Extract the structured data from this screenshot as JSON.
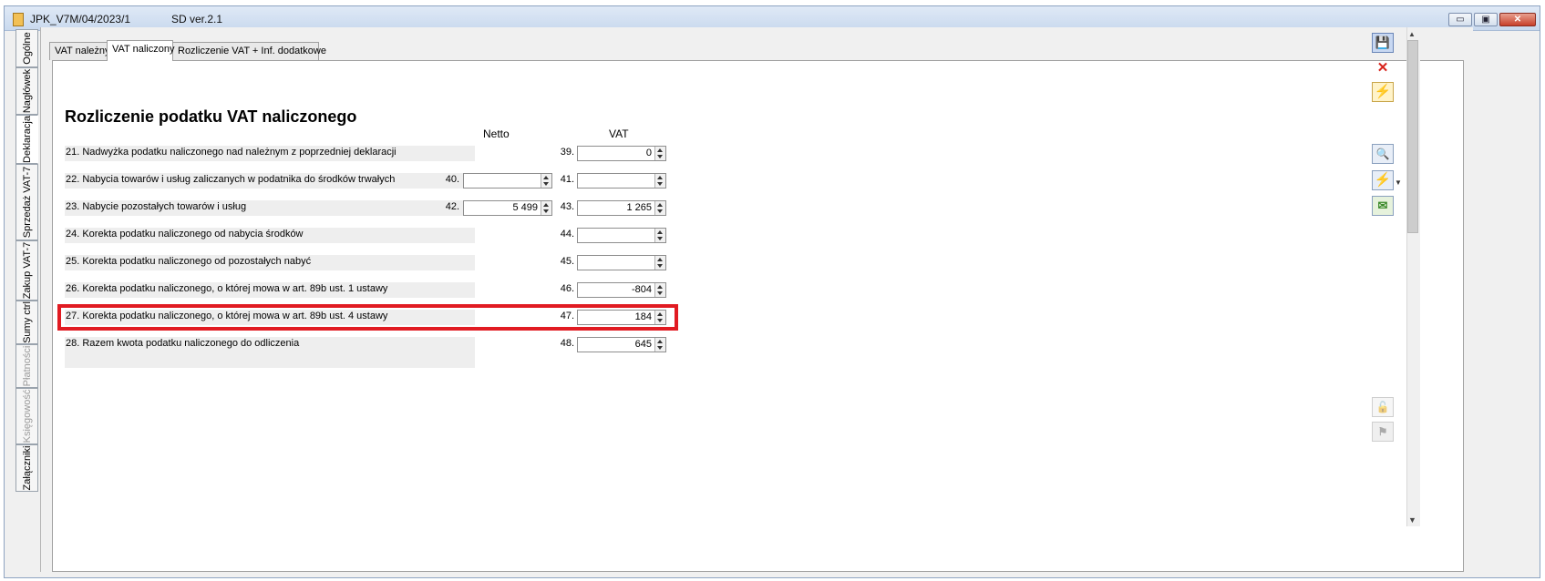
{
  "window": {
    "title": "JPK_V7M/04/2023/1",
    "version": "SD ver.2.1",
    "buttons": {
      "minimize": "▭",
      "maximize": "▣",
      "close": "✕"
    }
  },
  "side_tabs": [
    {
      "label": "Ogólne",
      "state": "normal"
    },
    {
      "label": "Nagłówek",
      "state": "normal"
    },
    {
      "label": "Deklaracja",
      "state": "active"
    },
    {
      "label": "Sprzedaż VAT-7",
      "state": "normal"
    },
    {
      "label": "Zakup VAT-7",
      "state": "normal"
    },
    {
      "label": "Sumy ctrl",
      "state": "normal"
    },
    {
      "label": "Płatności",
      "state": "disabled"
    },
    {
      "label": "Księgowość",
      "state": "disabled"
    },
    {
      "label": "Załączniki",
      "state": "normal"
    }
  ],
  "top_tabs": [
    {
      "label": "VAT należny",
      "active": false
    },
    {
      "label": "VAT naliczony",
      "active": true
    },
    {
      "label": "Rozliczenie VAT + Inf. dodatkowe",
      "active": false
    }
  ],
  "form": {
    "title": "Rozliczenie podatku VAT naliczonego",
    "col_netto": "Netto",
    "col_vat": "VAT",
    "rows": [
      {
        "label": "21. Nadwyżka podatku naliczonego nad należnym z poprzedniej deklaracji",
        "netto_num": "",
        "netto_value": null,
        "vat_num": "39.",
        "vat_value": "0"
      },
      {
        "label": "22. Nabycia towarów i usług zaliczanych w podatnika do środków trwałych",
        "netto_num": "40.",
        "netto_value": "",
        "vat_num": "41.",
        "vat_value": ""
      },
      {
        "label": "23. Nabycie pozostałych towarów i usług",
        "netto_num": "42.",
        "netto_value": "5 499",
        "vat_num": "43.",
        "vat_value": "1 265"
      },
      {
        "label": "24.  Korekta podatku naliczonego od nabycia środków",
        "netto_num": "",
        "netto_value": null,
        "vat_num": "44.",
        "vat_value": ""
      },
      {
        "label": "25. Korekta podatku naliczonego od pozostałych nabyć",
        "netto_num": "",
        "netto_value": null,
        "vat_num": "45.",
        "vat_value": ""
      },
      {
        "label": "26. Korekta podatku naliczonego, o której mowa w art. 89b ust. 1 ustawy",
        "netto_num": "",
        "netto_value": null,
        "vat_num": "46.",
        "vat_value": "-804"
      },
      {
        "label": "27. Korekta podatku naliczonego, o której mowa w art. 89b ust. 4 ustawy",
        "netto_num": "",
        "netto_value": null,
        "vat_num": "47.",
        "vat_value": "184"
      },
      {
        "label": "28.  Razem kwota podatku naliczonego do odliczenia",
        "netto_num": "",
        "netto_value": null,
        "vat_num": "48.",
        "vat_value": "645"
      }
    ]
  },
  "toolbar": [
    {
      "name": "save-icon",
      "glyph": "💾"
    },
    {
      "name": "close-icon",
      "glyph": "✕"
    },
    {
      "name": "lightning-icon",
      "glyph": "⚡"
    },
    {
      "name": "preview-icon",
      "glyph": "🔍"
    },
    {
      "name": "vat-calc-icon",
      "glyph": "⚡"
    },
    {
      "name": "send-icon",
      "glyph": "✉"
    },
    {
      "name": "unlock-icon",
      "glyph": "🔓"
    },
    {
      "name": "flag-icon",
      "glyph": "⚑"
    }
  ],
  "colors": {
    "highlight": "#e11b22",
    "active_tab": "#ffffff",
    "row_shading": "#eeeeee"
  }
}
